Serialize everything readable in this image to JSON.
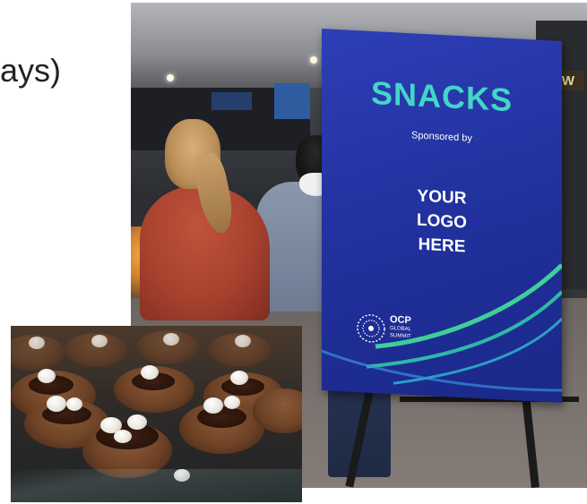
{
  "slide": {
    "partial_text": "ays)"
  },
  "photo_event": {
    "sign": {
      "title": "SNACKS",
      "sponsored_by": "Sponsored by",
      "placeholder_line1": "YOUR",
      "placeholder_line2": "LOGO",
      "placeholder_line3": "HERE",
      "brand_main": "OCP",
      "brand_sub1": "GLOBAL",
      "brand_sub2": "SUMMIT"
    },
    "background_booth_text": "NEW"
  },
  "photo_dessert": {},
  "colors": {
    "sign_blue": "#2232a0",
    "sign_title_teal": "#43d6c8",
    "sign_swoosh_green": "#3ecf9a"
  }
}
